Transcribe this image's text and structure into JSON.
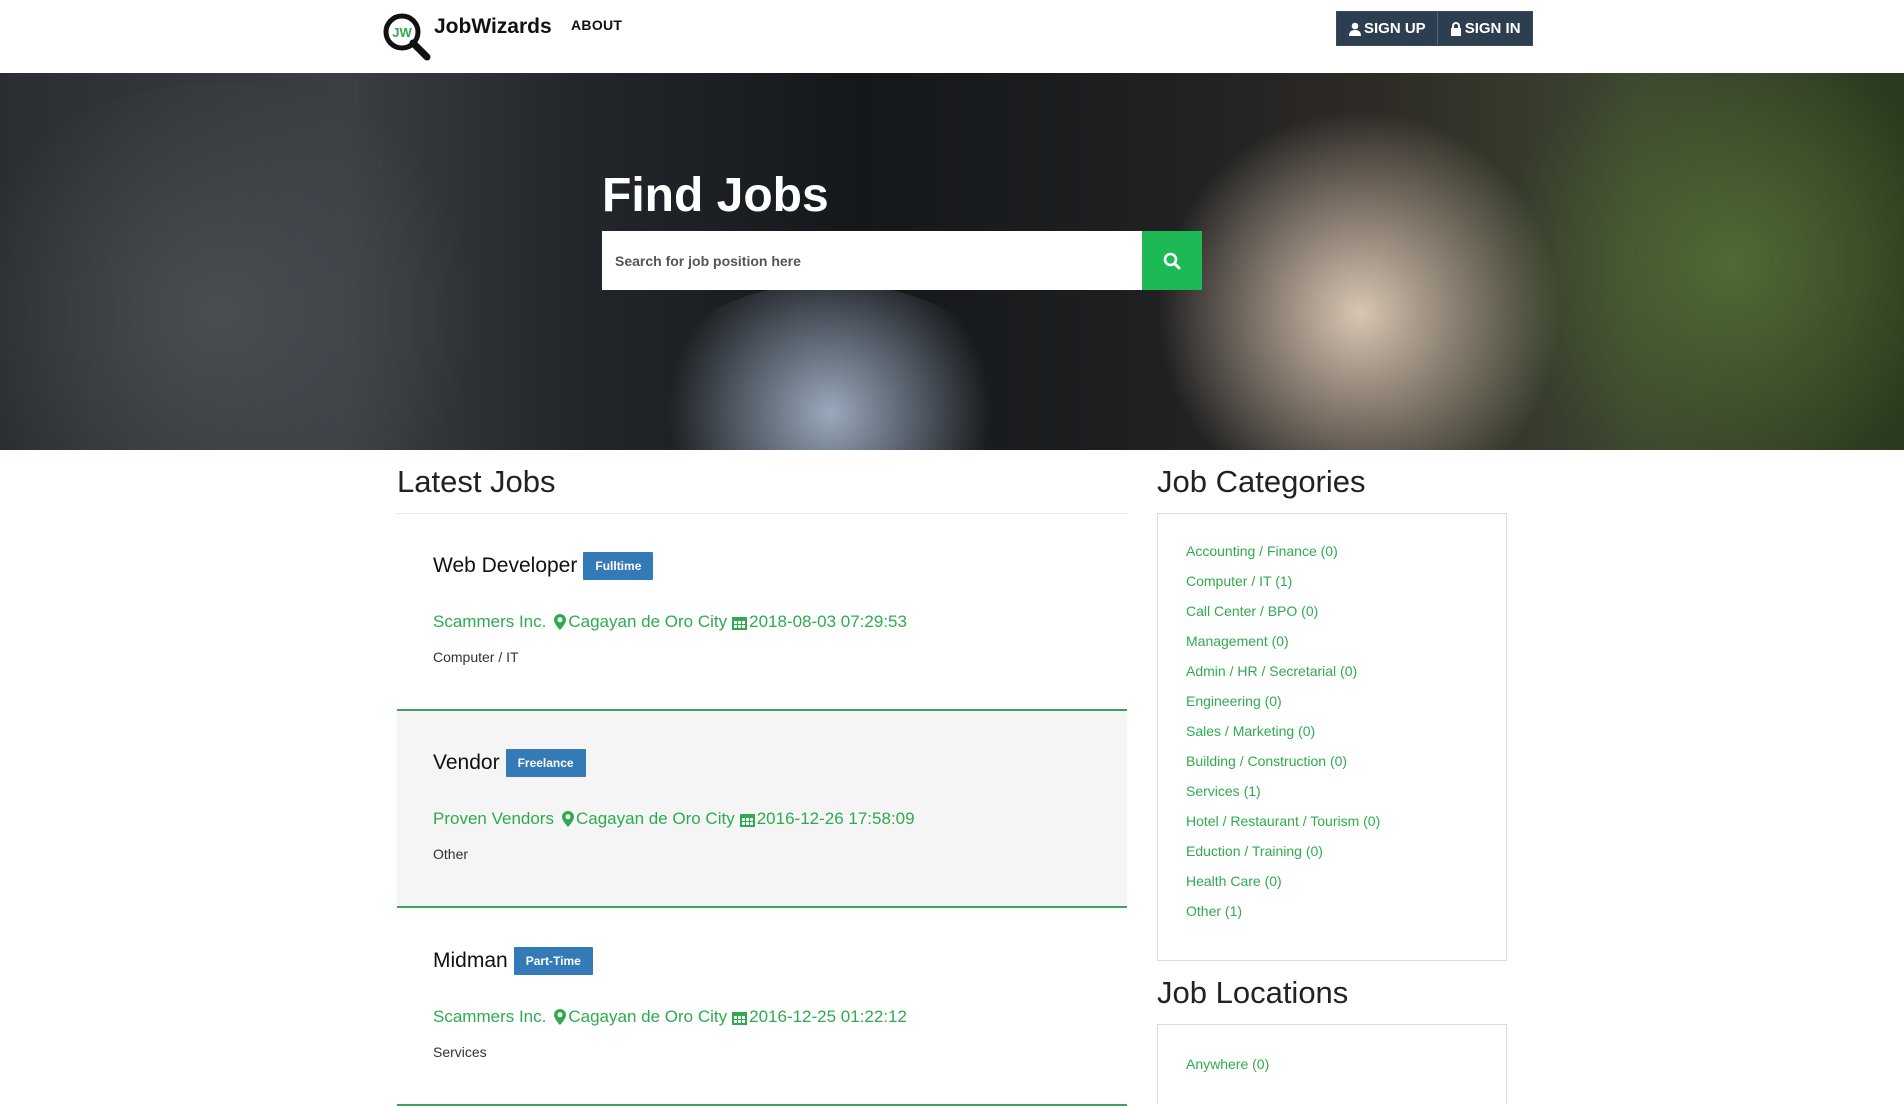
{
  "brand": {
    "name": "JobWizards",
    "logo_letters": "JW"
  },
  "nav": {
    "about": "ABOUT",
    "sign_up": "SIGN UP",
    "sign_in": "SIGN IN"
  },
  "hero": {
    "title": "Find Jobs",
    "search_placeholder": "Search for job position here"
  },
  "latest": {
    "title": "Latest Jobs",
    "jobs": [
      {
        "title": "Web Developer",
        "type": "Fulltime",
        "company": "Scammers Inc.",
        "location": "Cagayan de Oro City",
        "posted": "2018-08-03 07:29:53",
        "category": "Computer / IT"
      },
      {
        "title": "Vendor",
        "type": "Freelance",
        "company": "Proven Vendors",
        "location": "Cagayan de Oro City",
        "posted": "2016-12-26 17:58:09",
        "category": "Other"
      },
      {
        "title": "Midman",
        "type": "Part-Time",
        "company": "Scammers Inc.",
        "location": "Cagayan de Oro City",
        "posted": "2016-12-25 01:22:12",
        "category": "Services"
      }
    ]
  },
  "categories": {
    "title": "Job Categories",
    "items": [
      "Accounting / Finance (0)",
      "Computer / IT (1)",
      "Call Center / BPO (0)",
      "Management (0)",
      "Admin / HR / Secretarial (0)",
      "Engineering (0)",
      "Sales / Marketing (0)",
      "Building / Construction (0)",
      "Services (1)",
      "Hotel / Restaurant / Tourism (0)",
      "Eduction / Training (0)",
      "Health Care (0)",
      "Other (1)"
    ]
  },
  "locations": {
    "title": "Job Locations",
    "items": [
      "Anywhere (0)"
    ]
  },
  "colors": {
    "accent": "#2eab4f",
    "search_button": "#1db954",
    "badge": "#337ab7",
    "auth": "#2c3e50"
  }
}
